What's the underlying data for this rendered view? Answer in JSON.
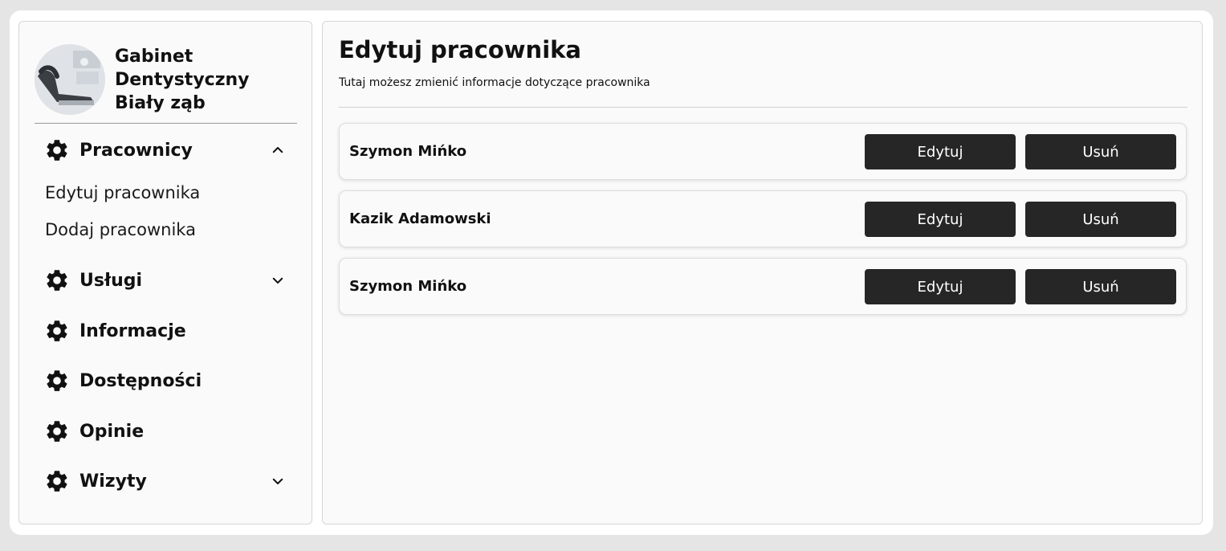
{
  "brand": {
    "line1": "Gabinet",
    "line2": "Dentystyczny",
    "line3": "Biały ząb"
  },
  "sidebar": {
    "items": [
      {
        "label": "Pracownicy",
        "icon": "gear-icon",
        "expanded": true,
        "subitems": [
          "Edytuj pracownika",
          "Dodaj pracownika"
        ]
      },
      {
        "label": "Usługi",
        "icon": "gear-icon",
        "expanded": false
      },
      {
        "label": "Informacje",
        "icon": "gear-icon"
      },
      {
        "label": "Dostępności",
        "icon": "gear-icon"
      },
      {
        "label": "Opinie",
        "icon": "gear-icon"
      },
      {
        "label": "Wizyty",
        "icon": "gear-icon",
        "expanded": false
      }
    ]
  },
  "main": {
    "title": "Edytuj pracownika",
    "subtitle": "Tutaj możesz zmienić informacje dotyczące pracownika",
    "employees": [
      {
        "name": "Szymon Mińko",
        "edit_label": "Edytuj",
        "delete_label": "Usuń"
      },
      {
        "name": "Kazik Adamowski",
        "edit_label": "Edytuj",
        "delete_label": "Usuń"
      },
      {
        "name": "Szymon Mińko",
        "edit_label": "Edytuj",
        "delete_label": "Usuń"
      }
    ]
  },
  "colors": {
    "button_bg": "#262626",
    "button_text": "#ffffff",
    "panel_bg": "#fafafa",
    "page_bg": "#e5e5e5"
  }
}
